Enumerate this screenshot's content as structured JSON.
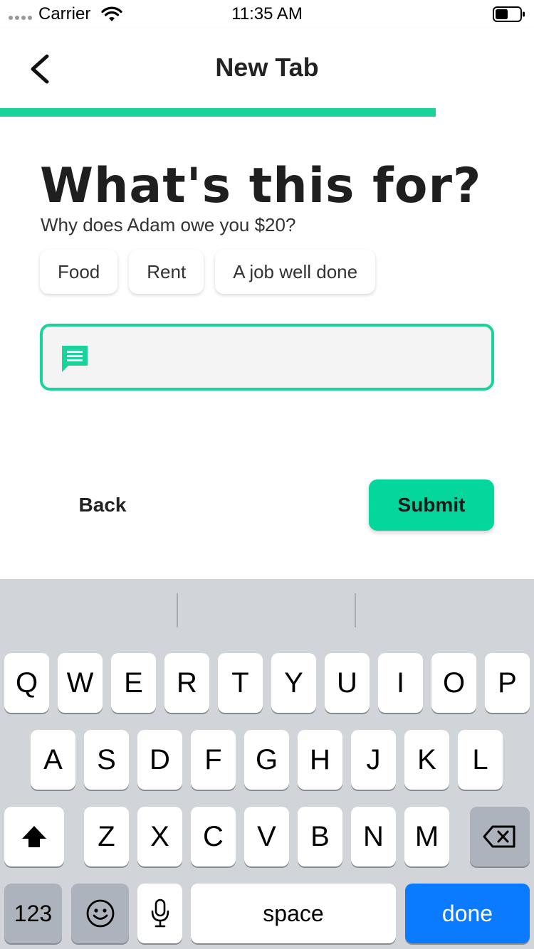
{
  "status_bar": {
    "carrier": "Carrier",
    "time": "11:35 AM"
  },
  "nav": {
    "title": "New Tab"
  },
  "progress": {
    "fraction": 0.816
  },
  "content": {
    "heading": "What's this for?",
    "subheading": "Why does Adam owe you $20?",
    "chips": [
      "Food",
      "Rent",
      "A job well done"
    ],
    "note_placeholder": "",
    "note_value": ""
  },
  "actions": {
    "back_label": "Back",
    "submit_label": "Submit"
  },
  "keyboard": {
    "row1": [
      "Q",
      "W",
      "E",
      "R",
      "T",
      "Y",
      "U",
      "I",
      "O",
      "P"
    ],
    "row2": [
      "A",
      "S",
      "D",
      "F",
      "G",
      "H",
      "J",
      "K",
      "L"
    ],
    "row3": [
      "Z",
      "X",
      "C",
      "V",
      "B",
      "N",
      "M"
    ],
    "numbers_label": "123",
    "space_label": "space",
    "done_label": "done"
  },
  "colors": {
    "accent": "#19d39a",
    "submit": "#05d69b",
    "done_key": "#0a7bff"
  },
  "icons": [
    "back-chevron-icon",
    "wifi-icon",
    "battery-icon",
    "message-icon",
    "shift-icon",
    "backspace-icon",
    "emoji-icon",
    "microphone-icon"
  ]
}
